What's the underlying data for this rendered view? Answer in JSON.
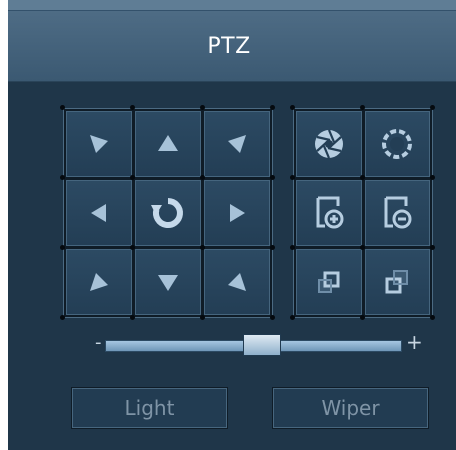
{
  "panel": {
    "title": "PTZ"
  },
  "direction_pad": {
    "buttons": [
      {
        "name": "pan-up-left",
        "icon": "arrow-up-left-icon"
      },
      {
        "name": "pan-up",
        "icon": "arrow-up-icon"
      },
      {
        "name": "pan-up-right",
        "icon": "arrow-up-right-icon"
      },
      {
        "name": "pan-left",
        "icon": "arrow-left-icon"
      },
      {
        "name": "auto-rotate",
        "icon": "rotate-icon"
      },
      {
        "name": "pan-right",
        "icon": "arrow-right-icon"
      },
      {
        "name": "pan-down-left",
        "icon": "arrow-down-left-icon"
      },
      {
        "name": "pan-down",
        "icon": "arrow-down-icon"
      },
      {
        "name": "pan-down-right",
        "icon": "arrow-down-right-icon"
      }
    ]
  },
  "lens_controls": {
    "buttons": [
      {
        "name": "iris-open",
        "icon": "aperture-open-icon"
      },
      {
        "name": "iris-close",
        "icon": "aperture-close-icon"
      },
      {
        "name": "zoom-in",
        "icon": "zoom-in-icon"
      },
      {
        "name": "zoom-out",
        "icon": "zoom-out-icon"
      },
      {
        "name": "focus-near",
        "icon": "focus-near-icon"
      },
      {
        "name": "focus-far",
        "icon": "focus-far-icon"
      }
    ]
  },
  "speed_slider": {
    "min_label": "-",
    "max_label": "+",
    "value_fraction": 0.53
  },
  "actions": {
    "light_label": "Light",
    "wiper_label": "Wiper"
  },
  "colors": {
    "panel_bg": "#1f3649",
    "header_bg": "#4e6c85",
    "icon_color": "#a7c2d8",
    "button_text": "#7f94a6"
  }
}
